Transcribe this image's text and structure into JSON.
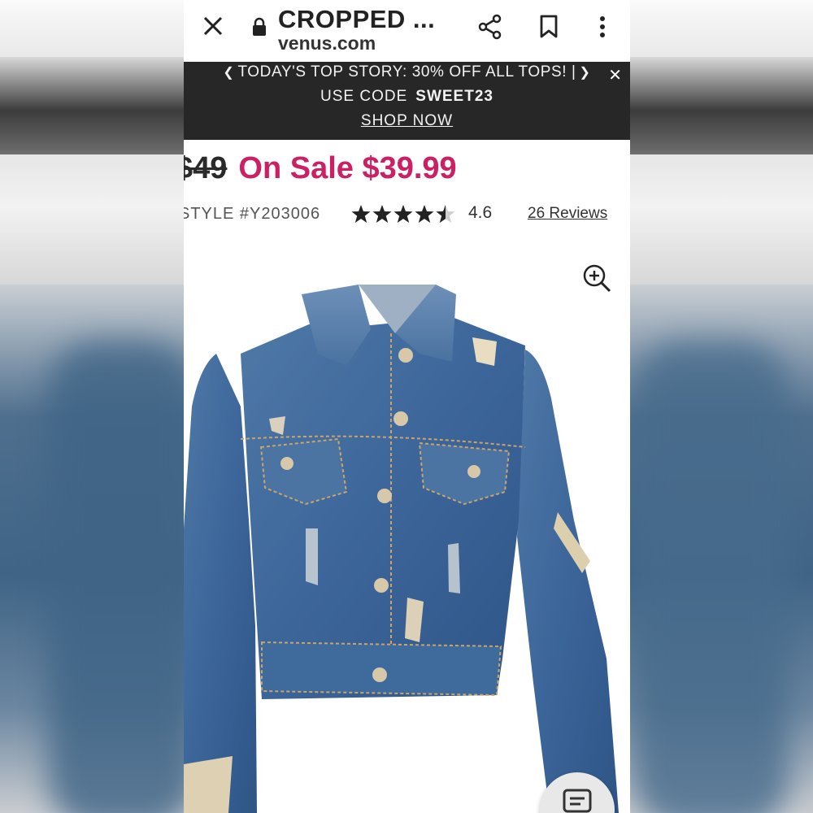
{
  "browser": {
    "page_title": "CROPPED ...",
    "url": "venus.com"
  },
  "promo": {
    "line1": "TODAY'S TOP STORY: 30% OFF ALL TOPS! |",
    "use_code_label": "USE CODE",
    "code": "SWEET23",
    "shop_now": "SHOP NOW"
  },
  "product": {
    "old_price": "$49",
    "sale_price": "On Sale $39.99",
    "style_number": "STYLE #Y203006",
    "rating": "4.6",
    "rating_fraction": 0.92,
    "reviews": "26 Reviews"
  },
  "icons": [
    "close-icon",
    "lock-icon",
    "share-icon",
    "bookmark-icon",
    "more-icon",
    "zoom-in-icon",
    "chat-icon"
  ],
  "colors": {
    "sale": "#cc1f64",
    "promo_bg": "#272727"
  }
}
